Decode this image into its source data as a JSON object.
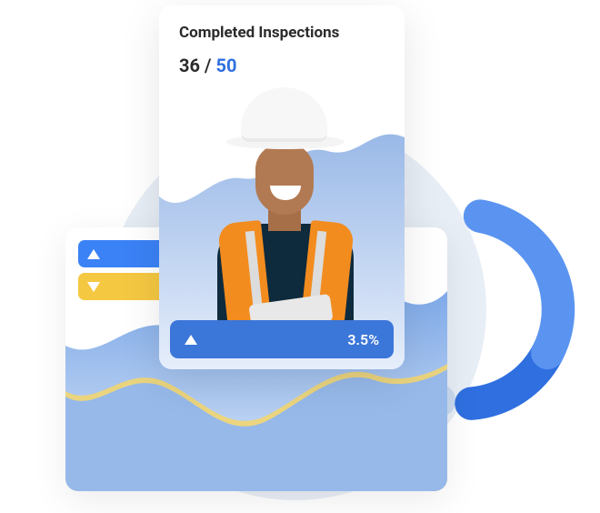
{
  "front_card": {
    "title": "Completed Inspections",
    "completed": "36",
    "separator": " / ",
    "total": "50",
    "metric_value": "3.5%"
  },
  "icons": {
    "up_triangle": "triangle-up-icon",
    "down_triangle": "triangle-down-icon"
  }
}
